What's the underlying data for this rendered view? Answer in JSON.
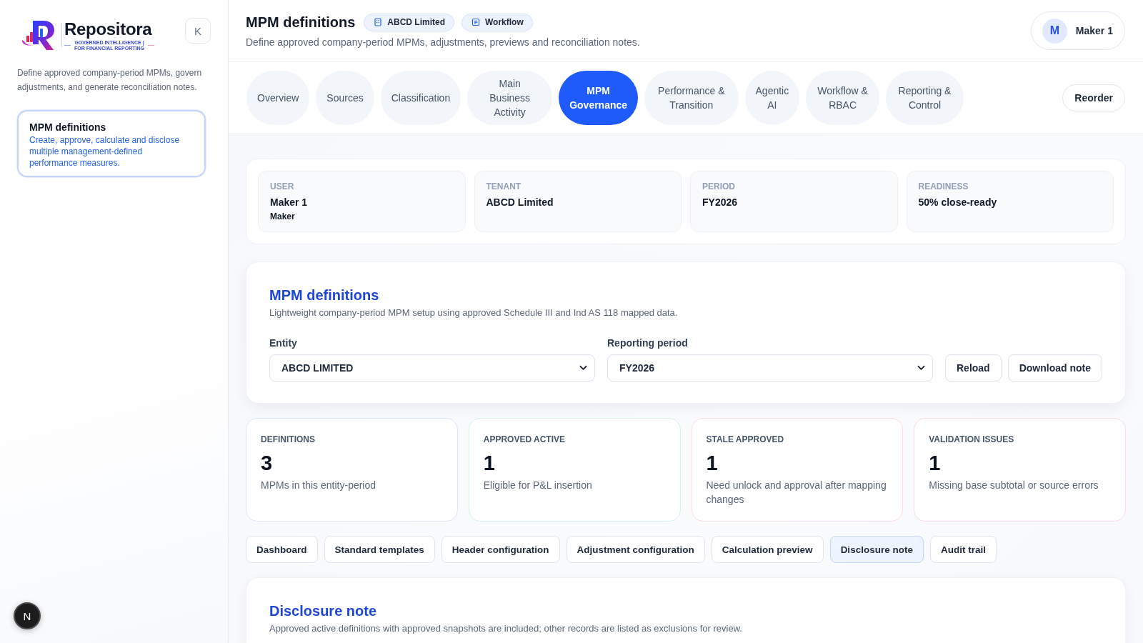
{
  "sidebar": {
    "logo": {
      "wordmark": "Repositora",
      "tagline": "GOVERNED INTELLIGENCE | FOR FINANCIAL REPORTING"
    },
    "collapse_button": "K",
    "description": "Define approved company-period MPMs, govern adjustments, and generate reconciliation notes.",
    "nav_items": [
      {
        "title": "MPM definitions",
        "description": "Create, approve, calculate and disclose multiple management-defined performance measures.",
        "selected": true
      }
    ]
  },
  "header": {
    "title": "MPM definitions",
    "badges": [
      {
        "kind": "tenant",
        "label": "ABCD Limited"
      },
      {
        "kind": "workflow",
        "label": "Workflow"
      }
    ],
    "subtitle": "Define approved company-period MPMs, adjustments, previews and reconciliation notes.",
    "user": {
      "initial": "M",
      "name": "Maker 1"
    }
  },
  "tabs": [
    {
      "label": "Overview",
      "selected": false
    },
    {
      "label": "Sources",
      "selected": false
    },
    {
      "label": "Classification",
      "selected": false
    },
    {
      "label": "Main Business Activity",
      "selected": false
    },
    {
      "label": "MPM Governance",
      "selected": true
    },
    {
      "label": "Performance & Transition",
      "selected": false
    },
    {
      "label": "Agentic AI",
      "selected": false
    },
    {
      "label": "Workflow & RBAC",
      "selected": false
    },
    {
      "label": "Reporting & Control",
      "selected": false
    }
  ],
  "reorder_button": "Reorder",
  "context_cards": [
    {
      "label": "USER",
      "value": "Maker 1",
      "detail": "Maker"
    },
    {
      "label": "TENANT",
      "value": "ABCD Limited"
    },
    {
      "label": "PERIOD",
      "value": "FY2026"
    },
    {
      "label": "READINESS",
      "value": "50% close-ready"
    }
  ],
  "definitions_panel": {
    "title": "MPM definitions",
    "subtitle": "Lightweight company-period MPM setup using approved Schedule III and Ind AS 118 mapped data.",
    "fields": [
      {
        "label": "Entity",
        "value": "ABCD LIMITED"
      },
      {
        "label": "Reporting period",
        "value": "FY2026"
      }
    ],
    "buttons": [
      "Reload",
      "Download note"
    ]
  },
  "stats": [
    {
      "label": "DEFINITIONS",
      "value": "3",
      "description": "MPMs in this entity-period",
      "color": "#dbe6fb"
    },
    {
      "label": "APPROVED ACTIVE",
      "value": "1",
      "description": "Eligible for P&L insertion",
      "color": "#d3f3ec"
    },
    {
      "label": "STALE APPROVED",
      "value": "1",
      "description": "Need unlock and approval after mapping changes",
      "color": "#fadde4"
    },
    {
      "label": "VALIDATION ISSUES",
      "value": "1",
      "description": "Missing base subtotal or source errors",
      "color": "#fadde4"
    }
  ],
  "section_tabs": [
    {
      "label": "Dashboard",
      "selected": false
    },
    {
      "label": "Standard templates",
      "selected": false
    },
    {
      "label": "Header configuration",
      "selected": false
    },
    {
      "label": "Adjustment configuration",
      "selected": false
    },
    {
      "label": "Calculation preview",
      "selected": false
    },
    {
      "label": "Disclosure note",
      "selected": true
    },
    {
      "label": "Audit trail",
      "selected": false
    }
  ],
  "disclosure_panel": {
    "title": "Disclosure note",
    "subtitle": "Approved active definitions with approved snapshots are included; other records are listed as exclusions for review."
  },
  "dev_indicator": "N"
}
